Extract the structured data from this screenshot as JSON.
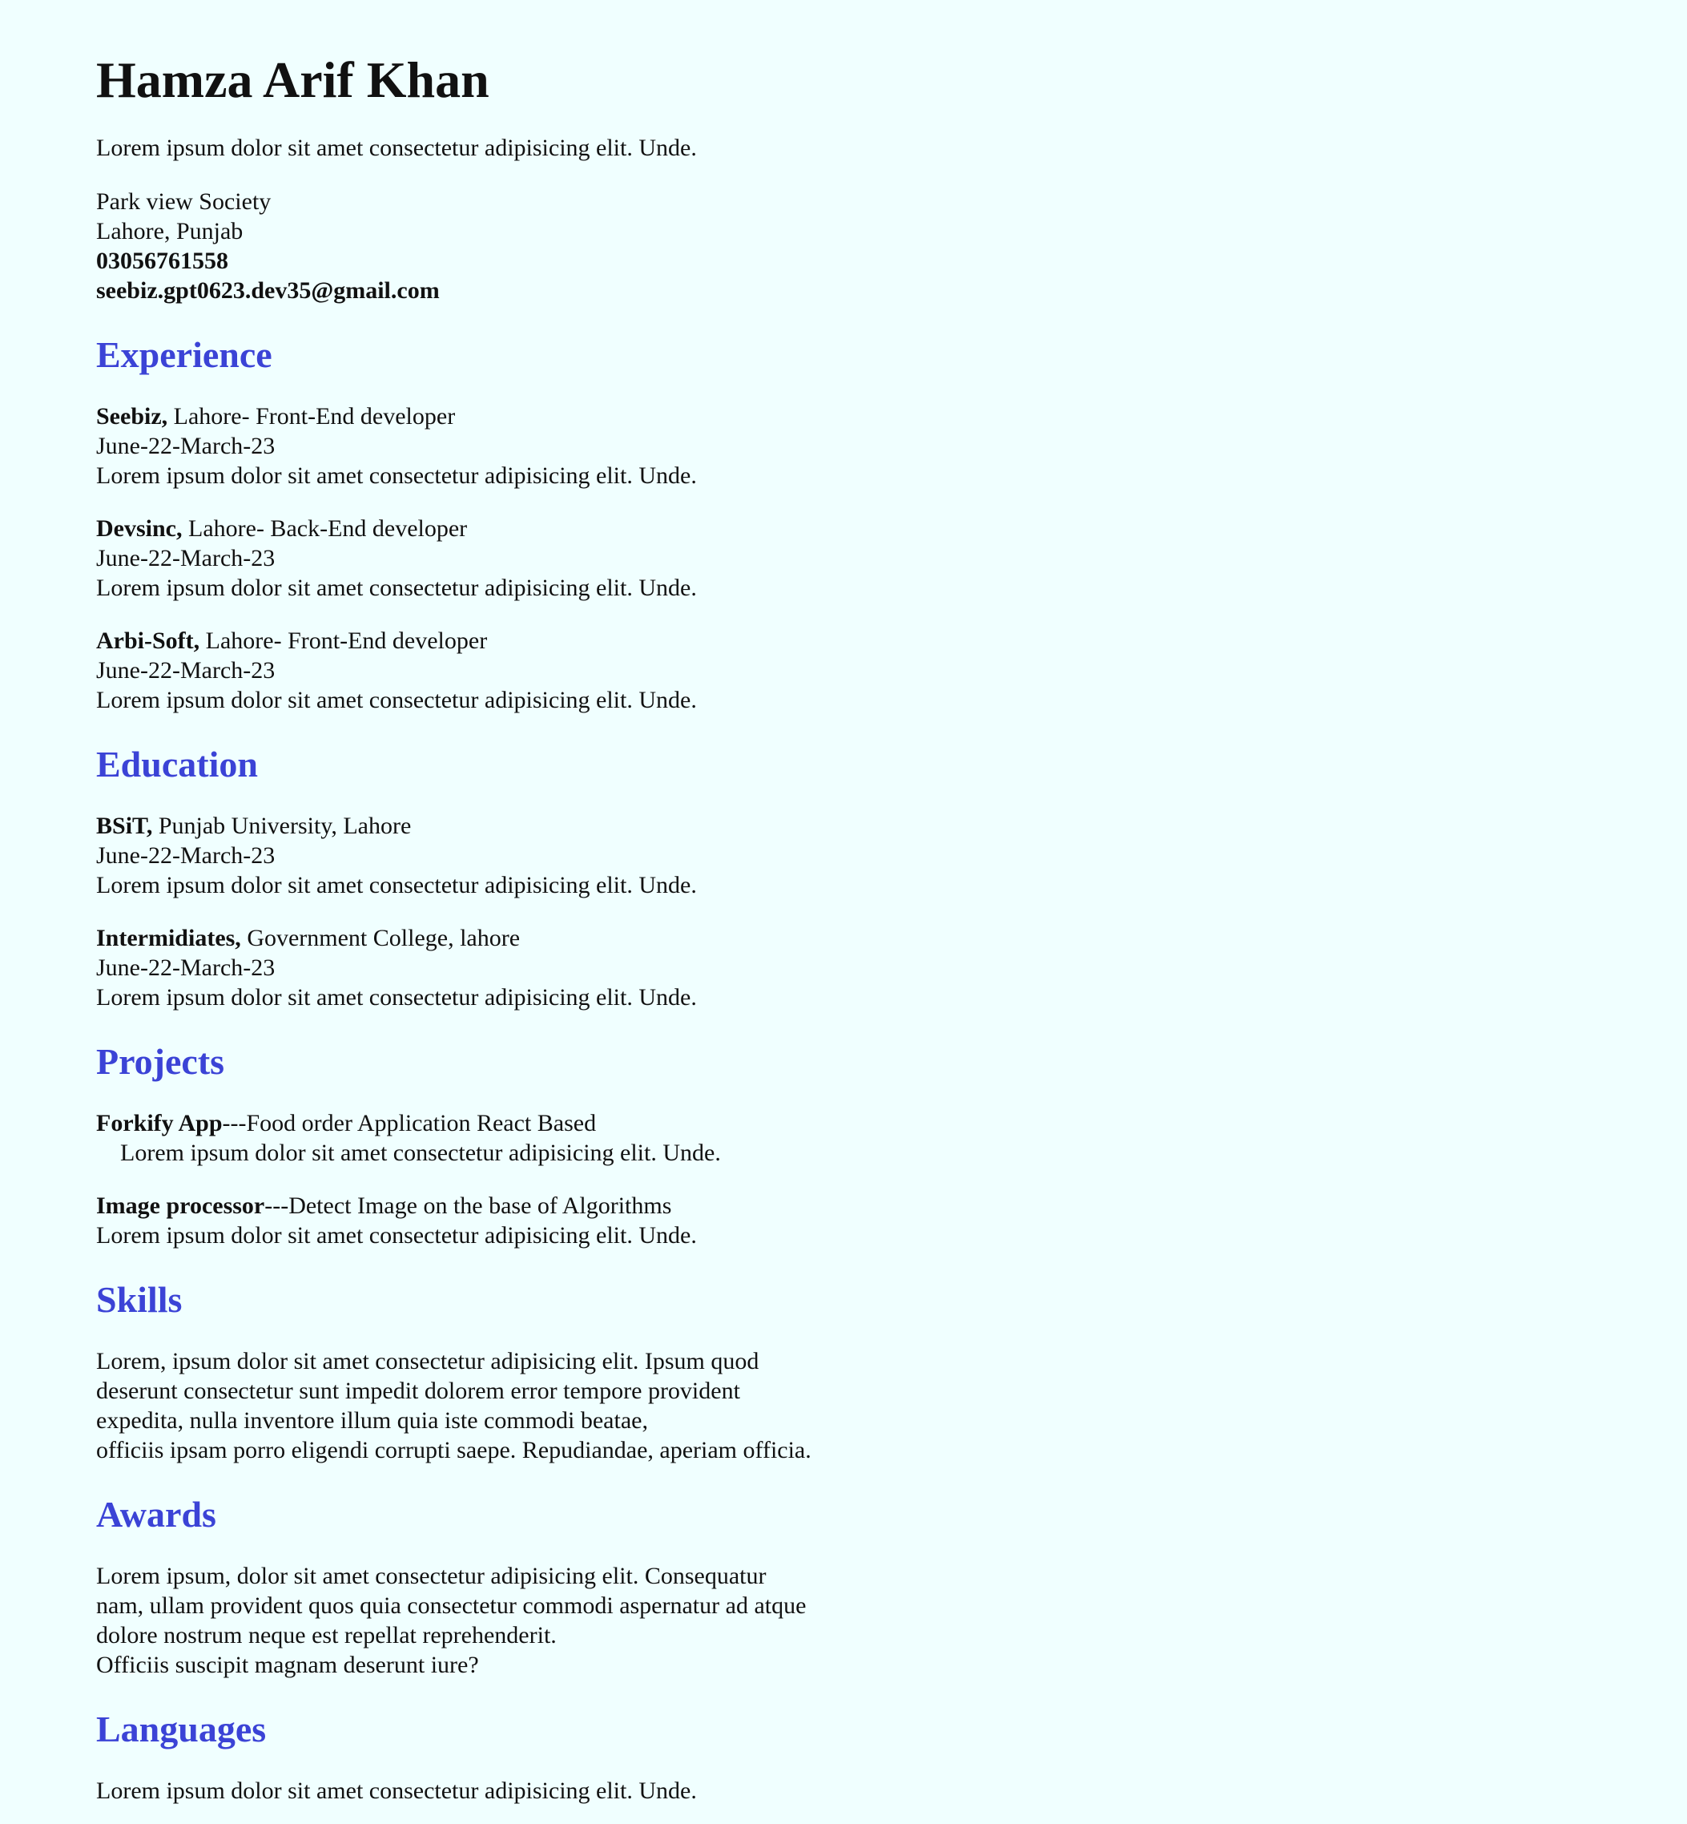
{
  "name": "Hamza Arif Khan",
  "intro": "Lorem ipsum dolor sit amet consectetur adipisicing elit. Unde.",
  "contact": {
    "address_line1": "Park view Society",
    "address_line2": "Lahore, Punjab",
    "phone": "03056761558",
    "email": "seebiz.gpt0623.dev35@gmail.com"
  },
  "colors": {
    "background": "#f0ffff",
    "section_heading": "#3b43d6"
  },
  "experience": {
    "title": "Experience",
    "items": [
      {
        "org": "Seebiz,",
        "detail": " Lahore- Front-End developer",
        "dates": "June-22-March-23",
        "desc": "Lorem ipsum dolor sit amet consectetur adipisicing elit. Unde."
      },
      {
        "org": "Devsinc,",
        "detail": " Lahore- Back-End developer",
        "dates": "June-22-March-23",
        "desc": "Lorem ipsum dolor sit amet consectetur adipisicing elit. Unde."
      },
      {
        "org": "Arbi-Soft,",
        "detail": " Lahore- Front-End developer",
        "dates": "June-22-March-23",
        "desc": "Lorem ipsum dolor sit amet consectetur adipisicing elit. Unde."
      }
    ]
  },
  "education": {
    "title": "Education",
    "items": [
      {
        "degree": "BSiT,",
        "detail": " Punjab University, Lahore",
        "dates": "June-22-March-23",
        "desc": "Lorem ipsum dolor sit amet consectetur adipisicing elit. Unde."
      },
      {
        "degree": "Intermidiates,",
        "detail": " Government College, lahore",
        "dates": "June-22-March-23",
        "desc": "Lorem ipsum dolor sit amet consectetur adipisicing elit. Unde."
      }
    ]
  },
  "projects": {
    "title": "Projects",
    "items": [
      {
        "name": "Forkify App",
        "detail": "---Food order Application React Based",
        "desc": "Lorem ipsum dolor sit amet consectetur adipisicing elit. Unde."
      },
      {
        "name": "Image processor",
        "detail": "---Detect Image on the base of Algorithms",
        "desc": "Lorem ipsum dolor sit amet consectetur adipisicing elit. Unde."
      }
    ]
  },
  "skills": {
    "title": "Skills",
    "lines": [
      "Lorem, ipsum dolor sit amet consectetur adipisicing elit. Ipsum quod",
      "deserunt consectetur sunt impedit dolorem error tempore provident",
      "expedita, nulla inventore illum quia iste commodi beatae,",
      "officiis ipsam porro eligendi corrupti saepe. Repudiandae, aperiam officia."
    ]
  },
  "awards": {
    "title": "Awards",
    "lines": [
      "Lorem ipsum, dolor sit amet consectetur adipisicing elit. Consequatur",
      "nam, ullam provident quos quia consectetur commodi aspernatur ad atque",
      "dolore nostrum neque est repellat reprehenderit.",
      "Officiis suscipit magnam deserunt iure?"
    ]
  },
  "languages": {
    "title": "Languages",
    "text": "Lorem ipsum dolor sit amet consectetur adipisicing elit. Unde."
  }
}
